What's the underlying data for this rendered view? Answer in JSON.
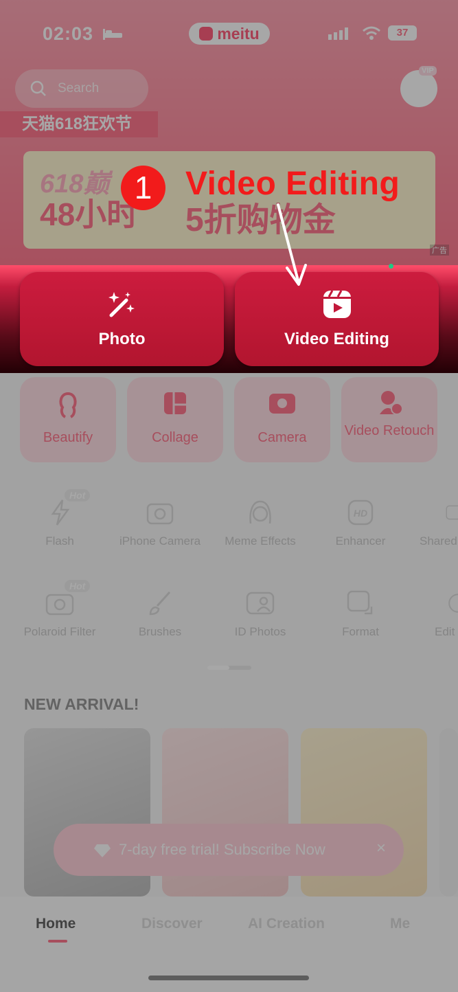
{
  "status_bar": {
    "time": "02:03",
    "app_pill": "meitu",
    "battery": "37"
  },
  "search": {
    "placeholder": "Search"
  },
  "vip": {
    "badge": "VIP"
  },
  "promo": {
    "strip": "天猫618狂欢节",
    "banner_line1": "618巅",
    "banner_line2": "48小时",
    "banner_line3": "5折购物金",
    "badge": "5折",
    "ad_tag": "广告"
  },
  "main_buttons": [
    {
      "label": "Photo",
      "icon": "magic-wand-icon"
    },
    {
      "label": "Video Editing",
      "icon": "video-editor-icon"
    }
  ],
  "categories": [
    {
      "label": "Beautify",
      "icon": "beautify-icon"
    },
    {
      "label": "Collage",
      "icon": "collage-icon"
    },
    {
      "label": "Camera",
      "icon": "camera-icon"
    },
    {
      "label": "Video Retouch",
      "icon": "video-retouch-icon"
    }
  ],
  "tools_row1": [
    {
      "label": "Flash",
      "icon": "flash-icon",
      "badge": "Hot"
    },
    {
      "label": "iPhone Camera",
      "icon": "camera-icon"
    },
    {
      "label": "Meme Effects",
      "icon": "face-icon"
    },
    {
      "label": "Enhancer",
      "icon": "hd-icon"
    },
    {
      "label": "Shared",
      "icon": "image-icon"
    }
  ],
  "tools_row2": [
    {
      "label": "Polaroid Filter",
      "icon": "polaroid-icon",
      "badge": "Hot"
    },
    {
      "label": "Brushes",
      "icon": "brush-icon"
    },
    {
      "label": "ID Photos",
      "icon": "id-photo-icon"
    },
    {
      "label": "Format",
      "icon": "format-icon"
    },
    {
      "label": "Edit",
      "icon": "edit-icon"
    }
  ],
  "sections": {
    "new_arrival": "NEW ARRIVAL!"
  },
  "subscribe": {
    "text": "7-day free trial! Subscribe Now",
    "close": "×"
  },
  "tabs": [
    {
      "label": "Home",
      "active": true
    },
    {
      "label": "Discover"
    },
    {
      "label": "AI Creation"
    },
    {
      "label": "Me"
    }
  ],
  "annotation": {
    "step": "1",
    "label": "Video Editing"
  },
  "colors": {
    "accent": "#ff4d6a",
    "button": "#c2183a",
    "annotation": "#f21b1b"
  }
}
